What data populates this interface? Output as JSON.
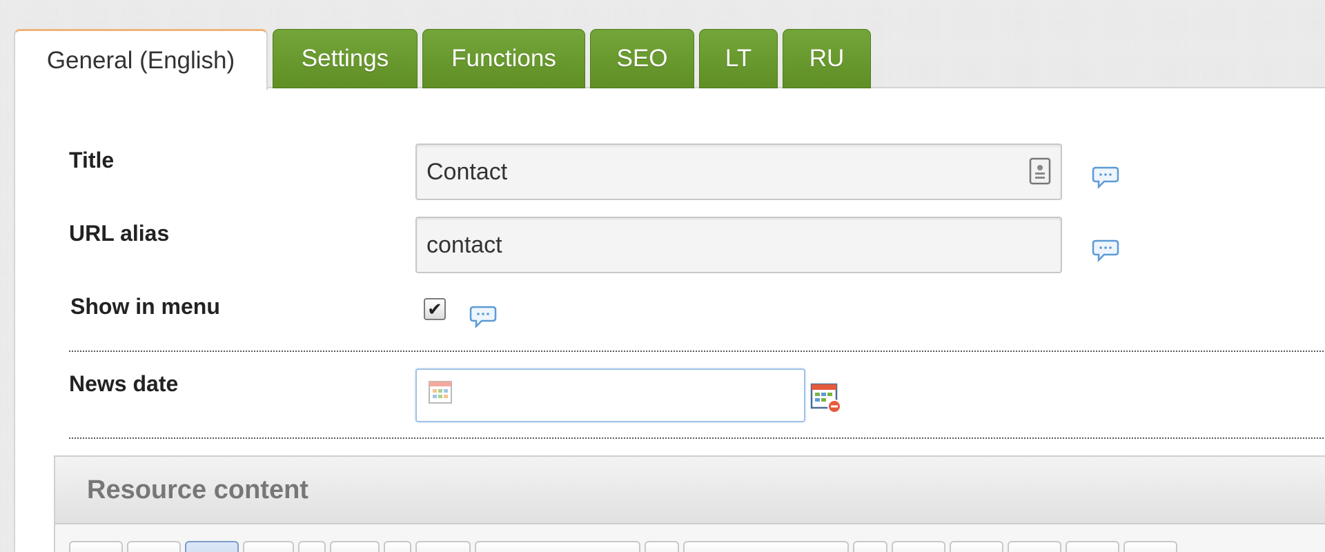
{
  "tabs": [
    {
      "label": "General (English)",
      "active": true
    },
    {
      "label": "Settings",
      "active": false
    },
    {
      "label": "Functions",
      "active": false
    },
    {
      "label": "SEO",
      "active": false
    },
    {
      "label": "LT",
      "active": false
    },
    {
      "label": "RU",
      "active": false
    }
  ],
  "form": {
    "title_label": "Title",
    "title_value": "Contact",
    "alias_label": "URL alias",
    "alias_value": "contact",
    "menu_label": "Show in menu",
    "menu_checked": true,
    "news_date_label": "News date",
    "news_date_value": ""
  },
  "content": {
    "header": "Resource content"
  },
  "icons": {
    "help": "speech-bubble-icon",
    "contact_card": "contact-card-icon",
    "calendar": "calendar-icon",
    "calendar_clear": "calendar-clear-icon",
    "checkmark": "✔"
  },
  "colors": {
    "tab_green": "#6a9a2f",
    "active_tab_accent": "#f0b27a",
    "date_focus_border": "#9ec3e6",
    "help_icon_blue": "#5b9bd5"
  }
}
